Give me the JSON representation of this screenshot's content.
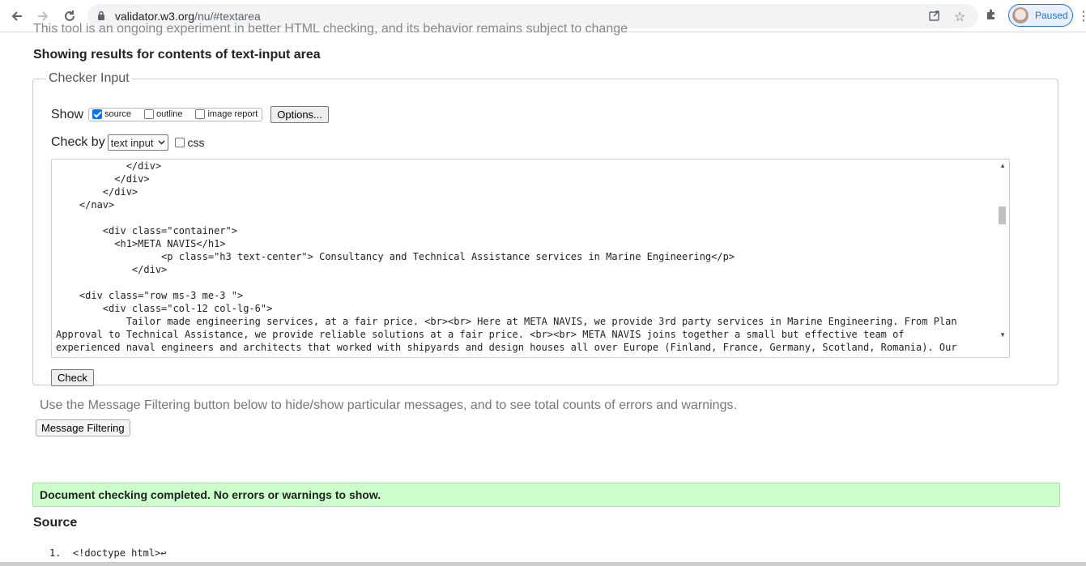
{
  "browser": {
    "url_host": "validator.w3.org",
    "url_path": "/nu/#textarea",
    "profile_status": "Paused"
  },
  "page": {
    "cutoff_text": "This tool is an ongoing experiment in better HTML checking, and its behavior remains subject to change",
    "results_title": "Showing results for contents of text-input area",
    "checker": {
      "legend": "Checker Input",
      "show_label": "Show",
      "show_options": [
        {
          "label": "source",
          "checked": true
        },
        {
          "label": "outline",
          "checked": false
        },
        {
          "label": "image report",
          "checked": false
        }
      ],
      "options_button": "Options...",
      "check_by_label": "Check by",
      "check_by_value": "text input",
      "css_label": "css",
      "code_lines": [
        "            </div>",
        "          </div>",
        "        </div>",
        "    </nav>",
        "",
        "        <div class=\"container\">",
        "          <h1>META NAVIS</h1>",
        "                  <p class=\"h3 text-center\"> Consultancy and Technical Assistance services in Marine Engineering</p>",
        "             </div>",
        "",
        "    <div class=\"row ms-3 me-3 \">",
        "        <div class=\"col-12 col-lg-6\">",
        "            Tailor made engineering services, at a fair price. <br><br> Here at META NAVIS, we provide 3rd party services in Marine Engineering. From Plan",
        "Approval to Technical Assistance, we provide reliable solutions at a fair price. <br><br> META NAVIS joins together a small but effective team of",
        "experienced naval engineers and architects that worked with shipyards and design houses all over Europe (Finland, France, Germany, Scotland, Romania). Our"
      ],
      "check_button": "Check"
    },
    "filter_note": "Use the Message Filtering button below to hide/show particular messages, and to see total counts of errors and warnings.",
    "filter_button": "Message Filtering",
    "success_message": "Document checking completed. No errors or warnings to show.",
    "source_title": "Source",
    "source_lines": [
      "1.  <!doctype html>↩"
    ]
  }
}
